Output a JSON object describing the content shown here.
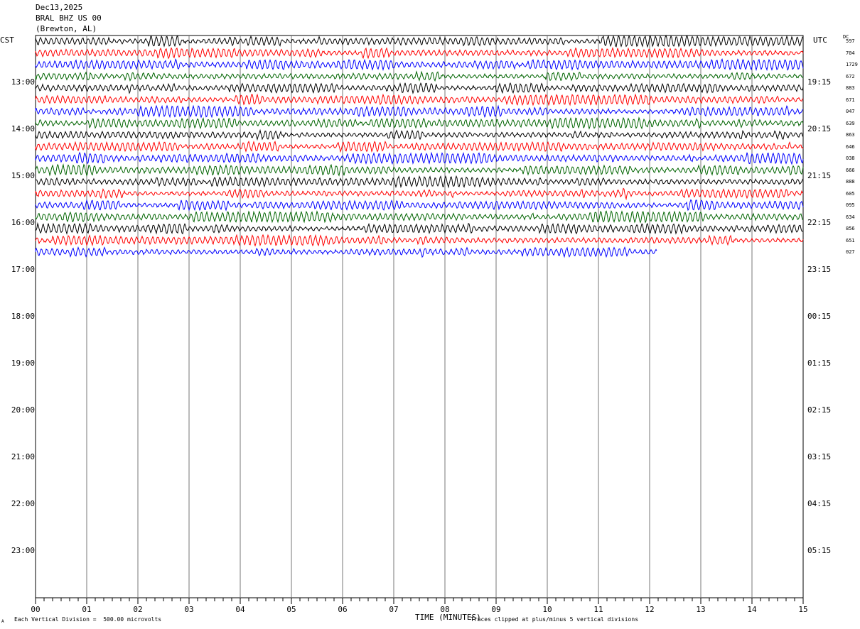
{
  "header": {
    "date": "Dec13,2025",
    "station": "BRAL BHZ US 00",
    "location": "(Brewton, AL)"
  },
  "axes": {
    "left_label": "CST",
    "right_label": "UTC",
    "dc_label": "DC",
    "xlabel": "TIME (MINUTES)"
  },
  "footer": {
    "scale_note": "Each Vertical Division =  500.00 microvolts",
    "clip_note": "Traces clipped at plus/minus 5 vertical divisions",
    "corner_mark": "A"
  },
  "chart_data": {
    "type": "line",
    "title": "",
    "xlabel": "TIME (MINUTES)",
    "ylabel": "",
    "xlim": [
      0,
      15
    ],
    "x_ticks": [
      "00",
      "01",
      "02",
      "03",
      "04",
      "05",
      "06",
      "07",
      "08",
      "09",
      "10",
      "11",
      "12",
      "13",
      "14",
      "15"
    ],
    "hour_labels_cst": [
      "13:00",
      "14:00",
      "15:00",
      "16:00",
      "17:00",
      "18:00",
      "19:00",
      "20:00",
      "21:00",
      "22:00",
      "23:00"
    ],
    "hour_labels_utc": [
      "19:15",
      "20:15",
      "21:15",
      "22:15",
      "23:15",
      "00:15",
      "01:15",
      "02:15",
      "03:15",
      "04:15",
      "05:15"
    ],
    "grid": "vertical-minute-lines",
    "trace_colors": [
      "#000000",
      "#ff0000",
      "#0000ff",
      "#006400"
    ],
    "trace_dc_offsets": [
      "597",
      "704",
      "1729",
      "672",
      "883",
      "671",
      "047",
      "639",
      "863",
      "646",
      "038",
      "666",
      "888",
      "605",
      "095",
      "634",
      "856",
      "651",
      "027"
    ],
    "trace_count": 19,
    "last_trace_end_minute": 12.15
  }
}
